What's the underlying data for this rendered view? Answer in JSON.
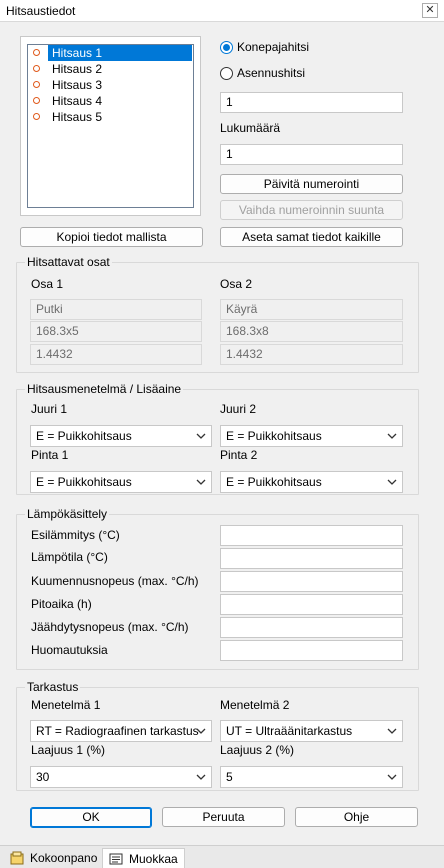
{
  "window": {
    "title": "Hitsaustiedot",
    "close": "✕"
  },
  "welds": {
    "items": [
      "Hitsaus 1",
      "Hitsaus 2",
      "Hitsaus 3",
      "Hitsaus 4",
      "Hitsaus 5"
    ],
    "selected_index": 0
  },
  "weld_type": {
    "option1": "Konepajahitsi",
    "option2": "Asennushitsi",
    "selected": "Konepajahitsi"
  },
  "number_value": "1",
  "count_label": "Lukumäärä",
  "count_value": "1",
  "buttons": {
    "update_numbering": "Päivitä numerointi",
    "change_direction": "Vaihda numeroinnin suunta",
    "copy_from_model": "Kopioi tiedot mallista",
    "set_same_all": "Aseta samat tiedot kaikille",
    "ok": "OK",
    "cancel": "Peruuta",
    "help": "Ohje"
  },
  "parts": {
    "title": "Hitsattavat osat",
    "part1_label": "Osa 1",
    "part2_label": "Osa 2",
    "part1": [
      "Putki",
      "168.3x5",
      "1.4432"
    ],
    "part2": [
      "Käyrä",
      "168.3x8",
      "1.4432"
    ]
  },
  "process": {
    "title": "Hitsausmenetelmä / Lisäaine",
    "root1_label": "Juuri 1",
    "root2_label": "Juuri 2",
    "root1_value": "E = Puikkohitsaus",
    "root2_value": "E = Puikkohitsaus",
    "face1_label": "Pinta 1",
    "face2_label": "Pinta 2",
    "face1_value": "E = Puikkohitsaus",
    "face2_value": "E = Puikkohitsaus"
  },
  "heat": {
    "title": "Lämpökäsittely",
    "fields": [
      {
        "label": "Esilämmitys (°C)",
        "value": ""
      },
      {
        "label": "Lämpötila (°C)",
        "value": ""
      },
      {
        "label": "Kuumennusnopeus (max. °C/h)",
        "value": ""
      },
      {
        "label": "Pitoaika (h)",
        "value": ""
      },
      {
        "label": "Jäähdytysnopeus (max. °C/h)",
        "value": ""
      },
      {
        "label": "Huomautuksia",
        "value": ""
      }
    ]
  },
  "inspection": {
    "title": "Tarkastus",
    "method1_label": "Menetelmä 1",
    "method2_label": "Menetelmä 2",
    "method1_value": "RT = Radiograafinen tarkastus",
    "method2_value": "UT = Ultraäänitarkastus",
    "extent1_label": "Laajuus 1 (%)",
    "extent2_label": "Laajuus 2 (%)",
    "extent1_value": "30",
    "extent2_value": "5"
  },
  "tabs": [
    {
      "label": "Kokoonpano",
      "icon": "assembly-icon"
    },
    {
      "label": "Muokkaa",
      "icon": "edit-icon"
    }
  ],
  "colors": {
    "accent": "#0078d7",
    "bullet": "#e05a1c"
  }
}
